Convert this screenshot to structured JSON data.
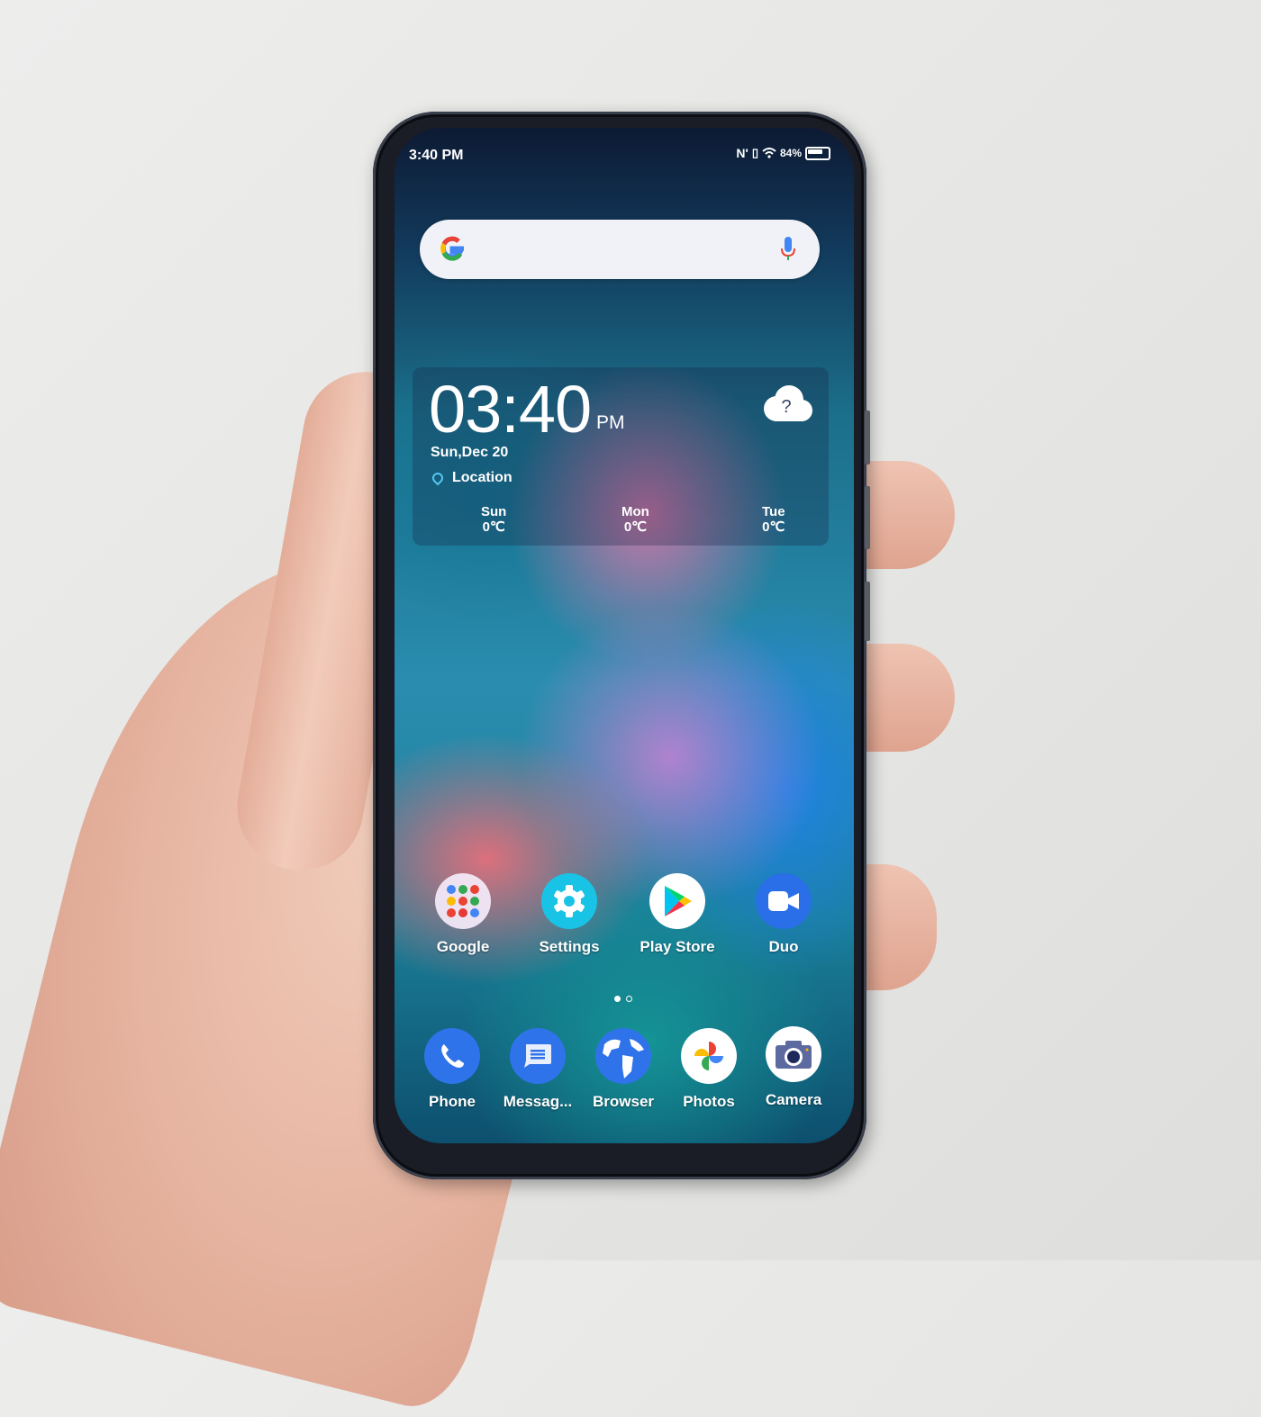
{
  "status_bar": {
    "time": "3:40 PM",
    "icons": [
      "nfc-icon",
      "vibrate-icon",
      "wifi-icon"
    ],
    "battery_percent_label": "84%",
    "battery_level": 0.84
  },
  "search_bar": {
    "logo": "google-g-icon",
    "mic": "mic-icon"
  },
  "clock_widget": {
    "time": "03:40",
    "ampm": "PM",
    "date": "Sun,Dec 20",
    "location": "Location",
    "weather_icon": "cloud-question-icon",
    "weather_glyph": "?",
    "forecast": [
      {
        "day": "Sun",
        "temp": "0℃"
      },
      {
        "day": "Mon",
        "temp": "0℃"
      },
      {
        "day": "Tue",
        "temp": "0℃"
      }
    ]
  },
  "home_apps": [
    {
      "label": "Google",
      "icon": "google-folder-icon"
    },
    {
      "label": "Settings",
      "icon": "gear-icon"
    },
    {
      "label": "Play Store",
      "icon": "play-store-icon"
    },
    {
      "label": "Duo",
      "icon": "video-camera-icon"
    }
  ],
  "page_indicator": {
    "pages": 2,
    "current": 1
  },
  "dock_apps": [
    {
      "label": "Phone",
      "icon": "phone-icon"
    },
    {
      "label": "Messag...",
      "icon": "message-icon"
    },
    {
      "label": "Browser",
      "icon": "globe-icon"
    },
    {
      "label": "Photos",
      "icon": "pinwheel-icon"
    },
    {
      "label": "Camera",
      "icon": "camera-icon"
    }
  ],
  "colors": {
    "google_blue": "#4285f4",
    "settings_cyan": "#19c3e6",
    "duo_blue": "#2a6ee8",
    "pin_cyan": "#54c9f0"
  }
}
